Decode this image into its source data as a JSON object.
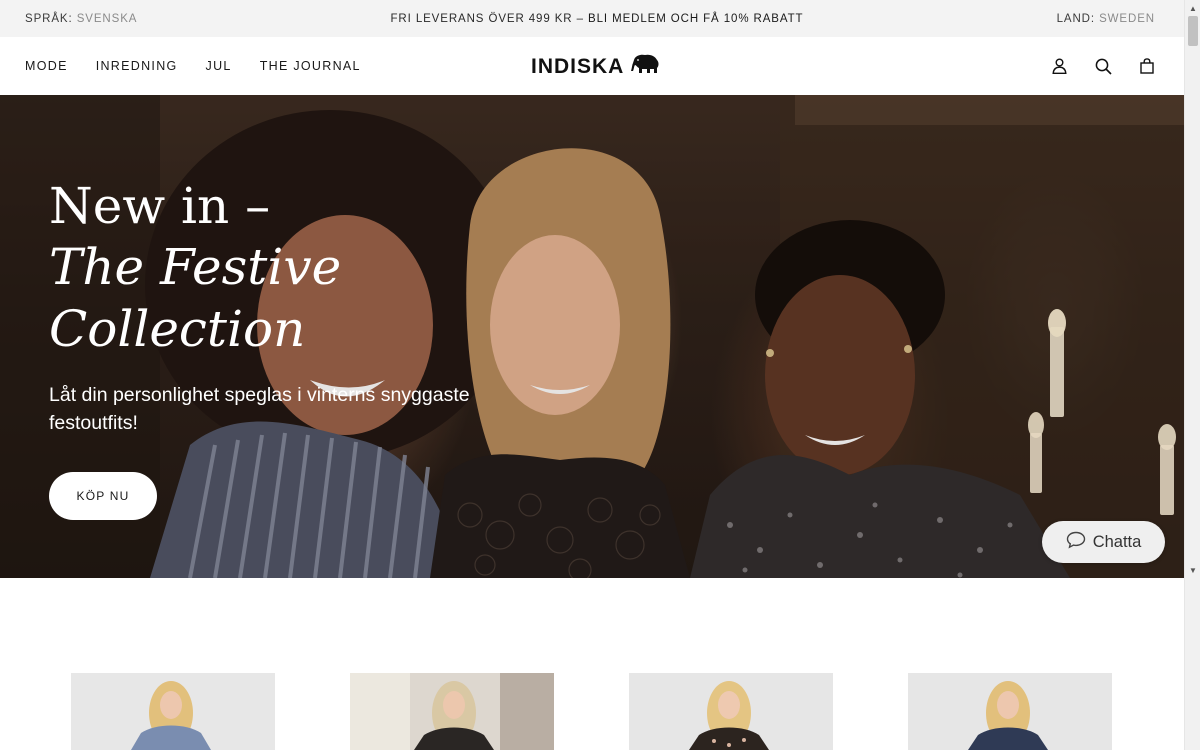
{
  "topbar": {
    "language_label": "SPRÅK:",
    "language_value": "SVENSKA",
    "promo_prefix": "FRI LEVERANS ÖVER 499 KR –",
    "promo_highlight": "BLI MEDLEM OCH FÅ 10% RABATT",
    "country_label": "LAND:",
    "country_value": "SWEDEN"
  },
  "nav": {
    "items": [
      "MODE",
      "INREDNING",
      "JUL",
      "THE JOURNAL"
    ]
  },
  "logo": {
    "text": "INDISKA",
    "icon": "elephant-icon"
  },
  "header_icons": [
    "account-icon",
    "search-icon",
    "bag-icon"
  ],
  "hero": {
    "title_line1": "New in –",
    "title_line2": "The Festive",
    "title_line3": "Collection",
    "subtitle": "Låt din personlighet speglas i vinterns snyggaste festoutfits!",
    "cta_label": "KÖP NU"
  },
  "chat": {
    "label": "Chatta",
    "icon": "chat-bubble-icon"
  },
  "products": [
    {
      "name": "product-card-1"
    },
    {
      "name": "product-card-2"
    },
    {
      "name": "product-card-3"
    },
    {
      "name": "product-card-4"
    }
  ]
}
